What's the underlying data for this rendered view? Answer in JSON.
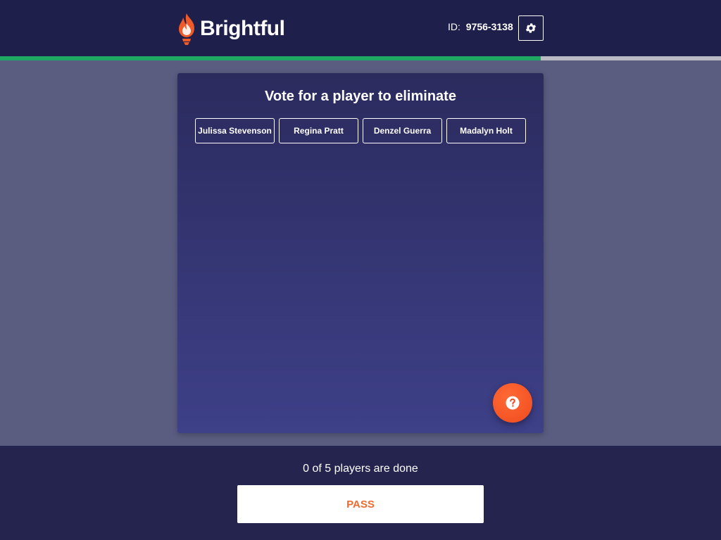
{
  "app": {
    "brand_name": "Brightful",
    "brand_color": "#f05a28"
  },
  "header": {
    "id_label": "ID:",
    "id_value": "9756-3138",
    "settings_icon": "gear-icon"
  },
  "progress": {
    "fraction": 0.75,
    "fill_color": "#1ea863"
  },
  "main": {
    "title": "Vote for a player to eliminate",
    "players": [
      {
        "name": "Julissa Stevenson"
      },
      {
        "name": "Regina Pratt"
      },
      {
        "name": "Denzel Guerra"
      },
      {
        "name": "Madalyn Holt"
      }
    ],
    "help_icon": "question-mark-icon"
  },
  "footer": {
    "status": "0 of 5 players are done",
    "pass_label": "PASS"
  }
}
